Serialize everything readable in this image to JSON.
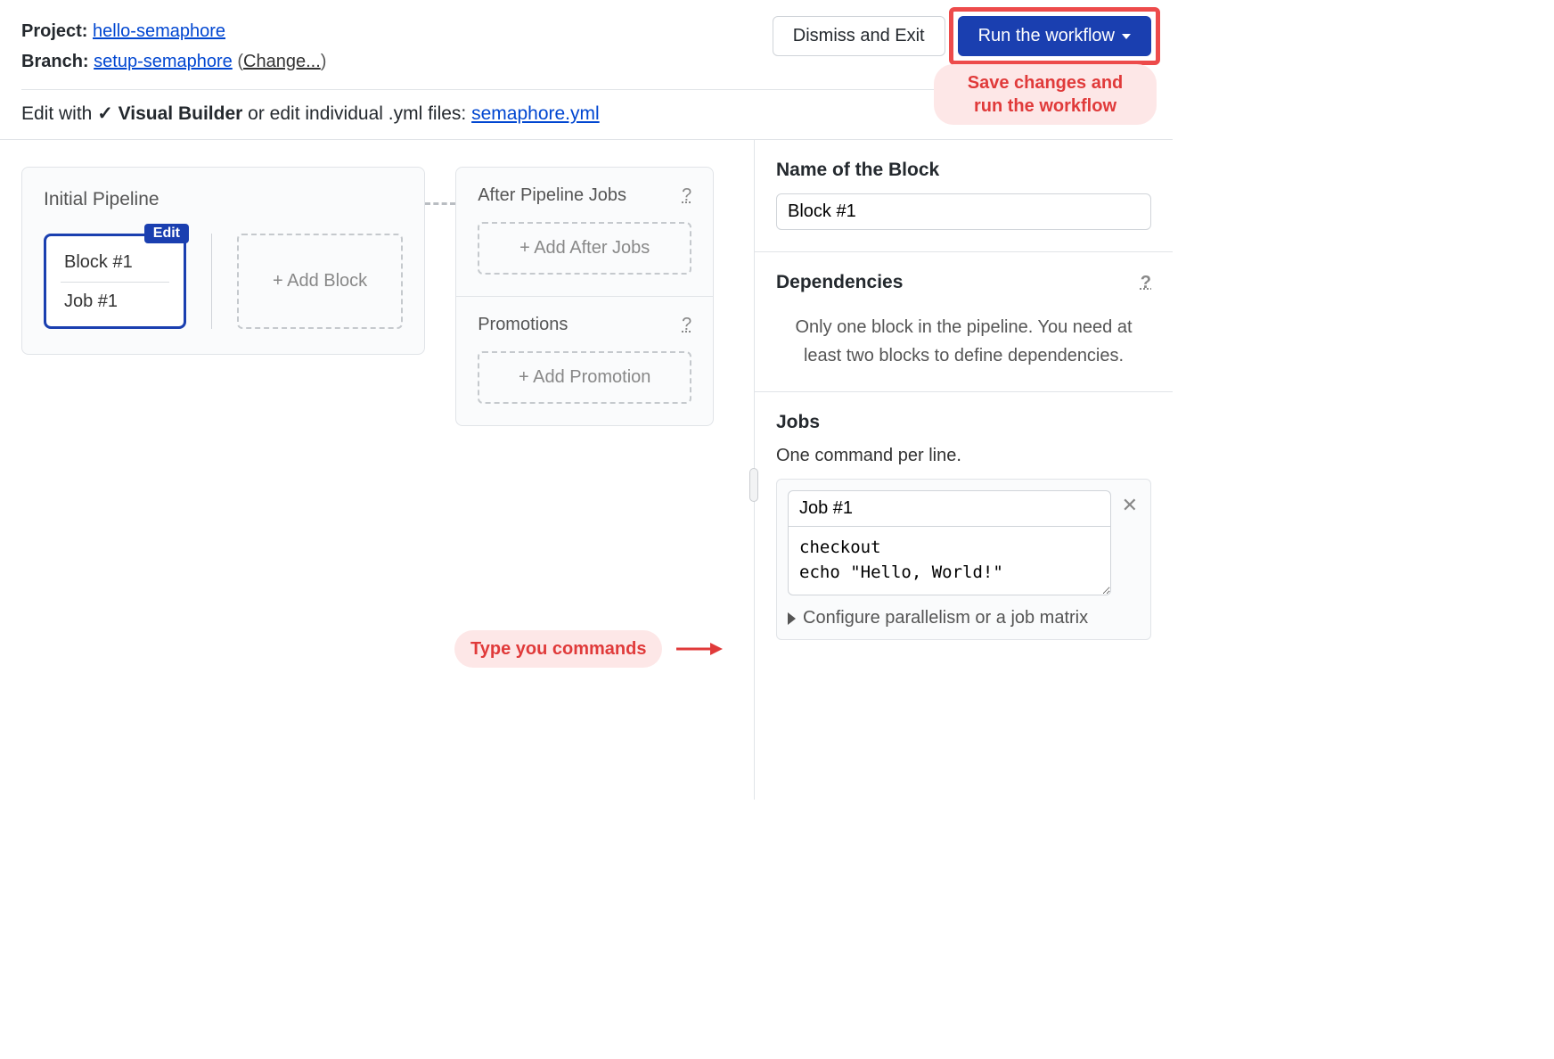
{
  "header": {
    "project_label": "Project:",
    "project_link": "hello-semaphore",
    "branch_label": "Branch:",
    "branch_link": "setup-semaphore",
    "change_text": "Change...",
    "dismiss_btn": "Dismiss and Exit",
    "run_btn": "Run the workflow",
    "edit_prefix": "Edit with",
    "visual_builder": "Visual Builder",
    "edit_suffix": " or edit individual .yml files: ",
    "yml_link": "semaphore.yml"
  },
  "annotations": {
    "save_run": "Save changes and\nrun the workflow",
    "type_cmds": "Type you commands"
  },
  "pipeline": {
    "title": "Initial Pipeline",
    "block": {
      "name": "Block #1",
      "job": "Job #1",
      "badge": "Edit"
    },
    "add_block": "+ Add Block"
  },
  "side": {
    "after_title": "After Pipeline Jobs",
    "after_btn": "+ Add After Jobs",
    "promo_title": "Promotions",
    "promo_btn": "+ Add Promotion",
    "help": "?"
  },
  "panel": {
    "name_label": "Name of the Block",
    "name_value": "Block #1",
    "deps_label": "Dependencies",
    "deps_msg": "Only one block in the pipeline. You need at least two blocks to define dependencies.",
    "jobs_label": "Jobs",
    "jobs_hint": "One command per line.",
    "job_name": "Job #1",
    "job_cmds": "checkout\necho \"Hello, World!\"",
    "config_text": "Configure parallelism or a job matrix",
    "help": "?"
  }
}
